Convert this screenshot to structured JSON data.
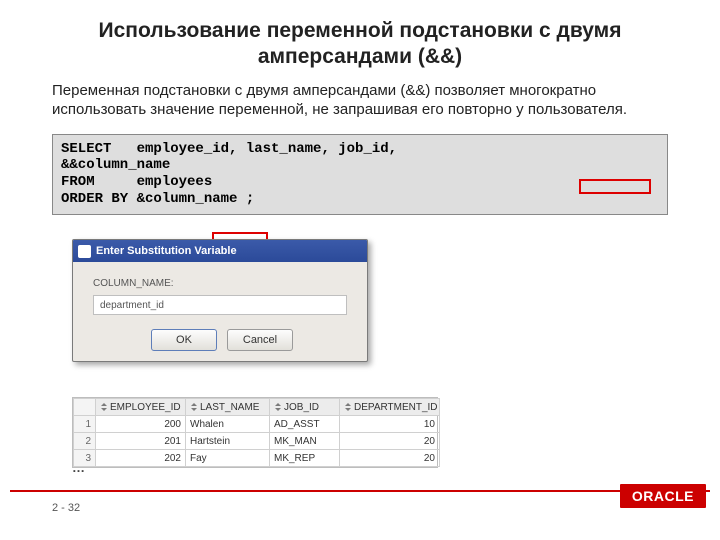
{
  "title": "Использование переменной подстановки с двумя амперсандами (&&)",
  "description": "Переменная подстановки с двумя амперсандами (&&) позволяет многократно использовать значение переменной, не запрашивая его повторно у пользователя.",
  "code": "SELECT   employee_id, last_name, job_id, \n&&column_name\nFROM     employees\nORDER BY &column_name ;",
  "dialog": {
    "title": "Enter Substitution Variable",
    "field_label": "COLUMN_NAME:",
    "field_value": "department_id",
    "ok_label": "OK",
    "cancel_label": "Cancel"
  },
  "results": {
    "columns": [
      "EMPLOYEE_ID",
      "LAST_NAME",
      "JOB_ID",
      "DEPARTMENT_ID"
    ],
    "rows": [
      {
        "n": "1",
        "emp": "200",
        "last": "Whalen",
        "job": "AD_ASST",
        "dept": "10"
      },
      {
        "n": "2",
        "emp": "201",
        "last": "Hartstein",
        "job": "MK_MAN",
        "dept": "20"
      },
      {
        "n": "3",
        "emp": "202",
        "last": "Fay",
        "job": "MK_REP",
        "dept": "20"
      }
    ]
  },
  "ellipsis": "…",
  "footer": {
    "page": "2 - 32",
    "brand": "ORACLE"
  }
}
